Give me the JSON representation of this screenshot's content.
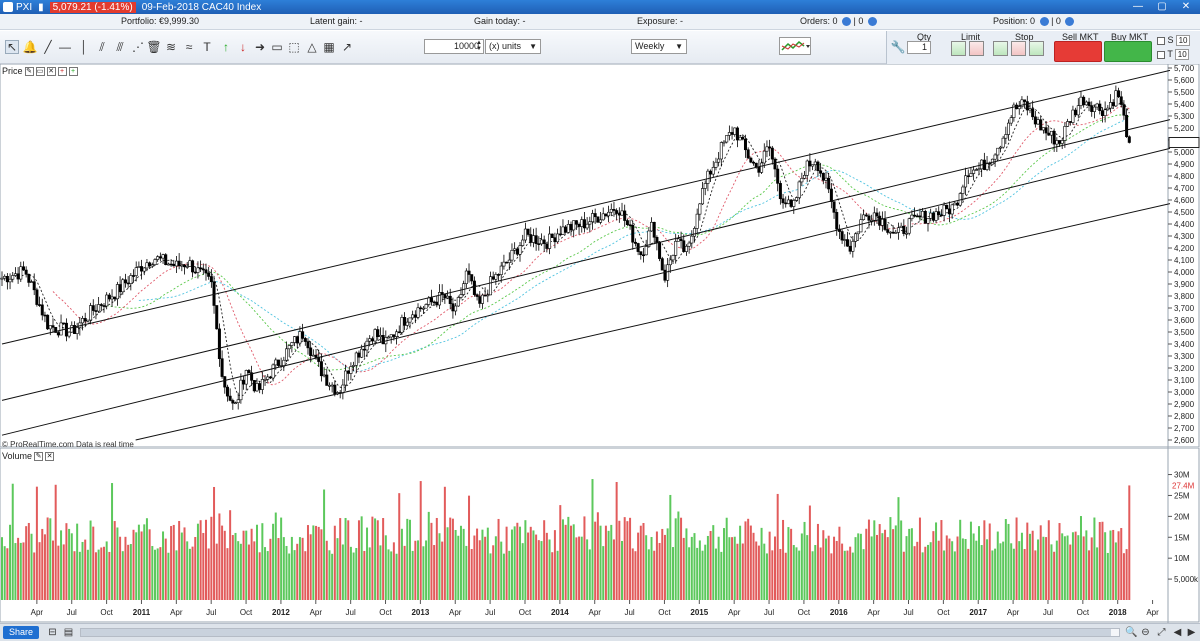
{
  "titlebar": {
    "symbol": "PXI",
    "change": "5,079.21 (-1.41%)",
    "title": "09-Feb-2018 CAC40 Index"
  },
  "status": {
    "portfolio": "Portfolio: €9,999.30",
    "latent_gain": "Latent gain: -",
    "gain_today": "Gain today: -",
    "exposure": "Exposure: -",
    "orders": "Orders: 0",
    "orders_sep": "| 0",
    "position": "Position: 0",
    "position_sep": "| 0"
  },
  "toolbar": {
    "quantity": "10000",
    "units": "(x) units",
    "period": "Weekly"
  },
  "trade": {
    "qty_label": "Qty",
    "qty_value": "1",
    "limit_label": "Limit",
    "stop_label": "Stop",
    "sell_label": "Sell MKT",
    "buy_label": "Buy MKT",
    "s_label": "S",
    "t_label": "T",
    "s_value": "10",
    "t_value": "10"
  },
  "panels": {
    "price_label": "Price",
    "volume_label": "Volume",
    "footer": "© ProRealTime.com  Data is real time"
  },
  "share_label": "Share",
  "chart_data": [
    {
      "type": "candlestick",
      "title": "CAC40 Index (Weekly)",
      "y_ticks": [
        "5,700",
        "5,600",
        "5,500",
        "5,400",
        "5,300",
        "5,200",
        "5,100",
        "5,000",
        "4,900",
        "4,800",
        "4,700",
        "4,600",
        "4,500",
        "4,400",
        "4,300",
        "4,200",
        "4,100",
        "4,000",
        "3,900",
        "3,800",
        "3,700",
        "3,600",
        "3,500",
        "3,400",
        "3,300",
        "3,200",
        "3,100",
        "3,000",
        "2,900",
        "2,800",
        "2,700",
        "2,600"
      ],
      "ylim": [
        2600,
        5700
      ],
      "last_close": 5079.21,
      "x_ticks": [
        "Apr",
        "Jul",
        "Oct",
        "2011",
        "Apr",
        "Jul",
        "Oct",
        "2012",
        "Apr",
        "Jul",
        "Oct",
        "2013",
        "Apr",
        "Jul",
        "Oct",
        "2014",
        "Apr",
        "Jul",
        "Oct",
        "2015",
        "Apr",
        "Jul",
        "Oct",
        "2016",
        "Apr",
        "Jul",
        "Oct",
        "2017",
        "Apr",
        "Jul",
        "Oct",
        "2018",
        "Apr"
      ],
      "anchors": [
        [
          "2010-01",
          3950
        ],
        [
          "2010-03",
          4010
        ],
        [
          "2010-05",
          3550
        ],
        [
          "2010-07",
          3500
        ],
        [
          "2010-09",
          3700
        ],
        [
          "2010-11",
          3850
        ],
        [
          "2011-01",
          4050
        ],
        [
          "2011-02",
          4120
        ],
        [
          "2011-04",
          4050
        ],
        [
          "2011-05",
          4080
        ],
        [
          "2011-07",
          3900
        ],
        [
          "2011-08",
          3100
        ],
        [
          "2011-09",
          2850
        ],
        [
          "2011-10",
          3200
        ],
        [
          "2011-11",
          3000
        ],
        [
          "2011-12",
          3150
        ],
        [
          "2012-02",
          3400
        ],
        [
          "2012-03",
          3500
        ],
        [
          "2012-04",
          3250
        ],
        [
          "2012-05",
          3100
        ],
        [
          "2012-06",
          3000
        ],
        [
          "2012-07",
          3250
        ],
        [
          "2012-09",
          3500
        ],
        [
          "2012-10",
          3400
        ],
        [
          "2012-12",
          3650
        ],
        [
          "2013-02",
          3750
        ],
        [
          "2013-03",
          3800
        ],
        [
          "2013-04",
          3650
        ],
        [
          "2013-05",
          4000
        ],
        [
          "2013-06",
          3700
        ],
        [
          "2013-07",
          3900
        ],
        [
          "2013-09",
          4150
        ],
        [
          "2013-10",
          4300
        ],
        [
          "2013-12",
          4250
        ],
        [
          "2014-01",
          4350
        ],
        [
          "2014-03",
          4400
        ],
        [
          "2014-05",
          4500
        ],
        [
          "2014-06",
          4550
        ],
        [
          "2014-08",
          4150
        ],
        [
          "2014-09",
          4400
        ],
        [
          "2014-10",
          3950
        ],
        [
          "2014-11",
          4250
        ],
        [
          "2014-12",
          4150
        ],
        [
          "2015-01",
          4600
        ],
        [
          "2015-02",
          4850
        ],
        [
          "2015-03",
          5050
        ],
        [
          "2015-04",
          5200
        ],
        [
          "2015-05",
          5000
        ],
        [
          "2015-06",
          4850
        ],
        [
          "2015-07",
          5050
        ],
        [
          "2015-08",
          4650
        ],
        [
          "2015-09",
          4500
        ],
        [
          "2015-10",
          4850
        ],
        [
          "2015-11",
          4950
        ],
        [
          "2015-12",
          4700
        ],
        [
          "2016-01",
          4350
        ],
        [
          "2016-02",
          4200
        ],
        [
          "2016-03",
          4450
        ],
        [
          "2016-04",
          4500
        ],
        [
          "2016-05",
          4400
        ],
        [
          "2016-06",
          4300
        ],
        [
          "2016-07",
          4400
        ],
        [
          "2016-08",
          4450
        ],
        [
          "2016-09",
          4480
        ],
        [
          "2016-10",
          4500
        ],
        [
          "2016-11",
          4550
        ],
        [
          "2016-12",
          4850
        ],
        [
          "2017-01",
          4850
        ],
        [
          "2017-02",
          4950
        ],
        [
          "2017-03",
          5100
        ],
        [
          "2017-04",
          5350
        ],
        [
          "2017-05",
          5400
        ],
        [
          "2017-06",
          5250
        ],
        [
          "2017-07",
          5150
        ],
        [
          "2017-08",
          5080
        ],
        [
          "2017-09",
          5300
        ],
        [
          "2017-10",
          5450
        ],
        [
          "2017-11",
          5380
        ],
        [
          "2017-12",
          5350
        ],
        [
          "2018-01",
          5500
        ],
        [
          "2018-02",
          5079
        ]
      ]
    },
    {
      "type": "bar",
      "title": "Volume",
      "y_ticks": [
        "30M",
        "25M",
        "20M",
        "15M",
        "10M",
        "5,000k"
      ],
      "ylim": [
        0,
        33000000
      ],
      "last_value_label": "27.4M"
    }
  ]
}
